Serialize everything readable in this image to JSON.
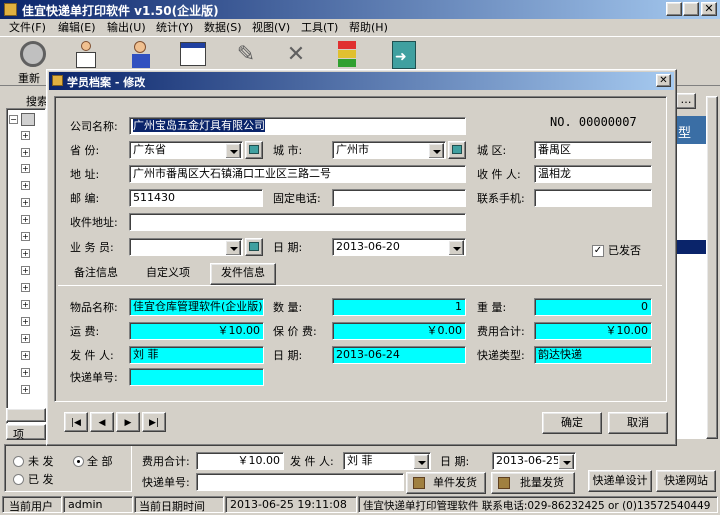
{
  "app": {
    "title": "佳宜快递单打印软件 v1.50(企业版)",
    "menu": [
      "文件(F)",
      "编辑(E)",
      "输出(U)",
      "统计(Y)",
      "数据(S)",
      "视图(V)",
      "工具(T)",
      "帮助(H)"
    ],
    "toolbar_label_left": "重新",
    "search_label": "搜索",
    "tree_bottom_label": "项",
    "right_panel_char": "型"
  },
  "dialog": {
    "title": "学员档案 - 修改",
    "number": "NO. 00000007",
    "labels": {
      "company": "公司名称:",
      "province": "省    份:",
      "city": "城    市:",
      "district": "城    区:",
      "address": "地    址:",
      "recipient": "收 件 人:",
      "postcode": "邮    编:",
      "phone": "固定电话:",
      "mobile": "联系手机:",
      "recv_address": "收件地址:",
      "salesman": "业 务 员:",
      "date": "日    期:",
      "sent": "已发否"
    },
    "values": {
      "company": "广州宝岛五金灯具有限公司",
      "province": "广东省",
      "city": "广州市",
      "district": "番禺区",
      "address": "广州市番禺区大石镇涌口工业区三路二号",
      "recipient": "温相龙",
      "postcode": "511430",
      "phone": "",
      "mobile": "",
      "recv_address": "",
      "salesman": "",
      "date": "2013-06-20"
    },
    "tabs": [
      "备注信息",
      "自定义项",
      "发件信息"
    ],
    "ship_labels": {
      "item": "物品名称:",
      "qty": "数    量:",
      "weight": "重    量:",
      "freight": "运    费:",
      "insurance": "保 价 费:",
      "total": "费用合计:",
      "sender": "发 件 人:",
      "ship_date": "日    期:",
      "courier": "快递类型:",
      "tracking": "快递单号:"
    },
    "ship_values": {
      "item": "佳宜仓库管理软件(企业版)",
      "qty": "1",
      "weight": "0",
      "freight": "￥10.00",
      "insurance": "￥0.00",
      "total": "￥10.00",
      "sender": "刘  菲",
      "ship_date": "2013-06-24",
      "courier": "韵达快递",
      "tracking": ""
    },
    "nav": [
      "|◀",
      "◀",
      "▶",
      "▶|"
    ],
    "ok": "确定",
    "cancel": "取消"
  },
  "bottom": {
    "radios": {
      "unsent": "未 发",
      "all": "全 部",
      "sent": "已 发"
    },
    "cost_label": "费用合计:",
    "cost_value": "￥10.00",
    "sender_label": "发 件 人:",
    "sender_value": "刘  菲",
    "date_label": "日    期:",
    "date_value": "2013-06-25",
    "tracking_label": "快递单号:",
    "tracking_value": "",
    "single_btn": "单件发货",
    "batch_btn": "批量发货",
    "design_btn": "快递单设计",
    "website_btn": "快递网站"
  },
  "status": {
    "user_label": "当前用户",
    "user": "admin",
    "date_label": "当前日期时间",
    "datetime": "2013-06-25 19:11:08",
    "info": "佳宜快递单打印管理软件 联系电话:029-86232425 or (0)13572540449"
  }
}
